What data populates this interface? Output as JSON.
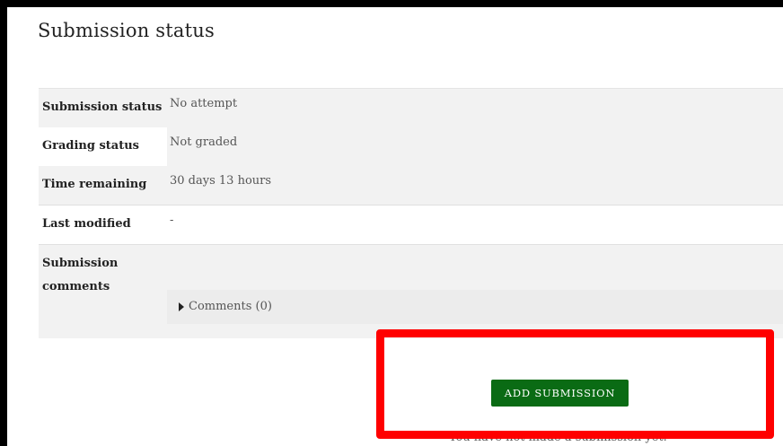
{
  "page": {
    "title": "Submission status"
  },
  "status_table": {
    "rows": [
      {
        "label": "Submission status",
        "value": "No attempt"
      },
      {
        "label": "Grading status",
        "value": "Not graded"
      },
      {
        "label": "Time remaining",
        "value": "30 days 13 hours"
      },
      {
        "label": "Last modified",
        "value": "-"
      },
      {
        "label": "Submission comments",
        "value": ""
      }
    ],
    "comments_toggle": "Comments (0)"
  },
  "actions": {
    "add_submission_label": "Add submission",
    "note": "You have not made a submission yet."
  },
  "colors": {
    "button_bg": "#0a6b14",
    "highlight_border": "#ff0000",
    "row_bg": "#f2f2f2"
  },
  "icons": {
    "comments_toggle": "caret-right-icon"
  }
}
